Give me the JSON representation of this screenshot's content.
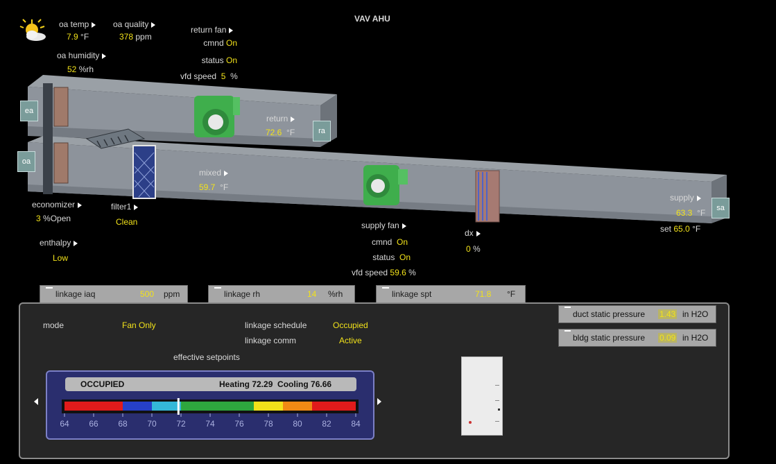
{
  "title": "VAV AHU",
  "outdoor": {
    "temp_label": "oa temp",
    "temp_value": "7.9",
    "temp_unit": "°F",
    "quality_label": "oa quality",
    "quality_value": "378",
    "quality_unit": "ppm",
    "humidity_label": "oa humidity",
    "humidity_value": "52",
    "humidity_unit": "%rh"
  },
  "return_fan": {
    "label": "return fan",
    "cmnd_label": "cmnd",
    "cmnd_value": "On",
    "status_label": "status",
    "status_value": "On",
    "speed_label": "vfd speed",
    "speed_value": "5",
    "speed_unit": "%"
  },
  "return_air": {
    "label": "return",
    "value": "72.6",
    "unit": "°F"
  },
  "mixed_air": {
    "label": "mixed",
    "value": "59.7",
    "unit": "°F"
  },
  "economizer": {
    "label": "economizer",
    "value": "3",
    "unit": "%Open"
  },
  "filter": {
    "label": "filter1",
    "value": "Clean"
  },
  "enthalpy": {
    "label": "enthalpy",
    "value": "Low"
  },
  "supply_fan": {
    "label": "supply fan",
    "cmnd_label": "cmnd",
    "cmnd_value": "On",
    "status_label": "status",
    "status_value": "On",
    "speed_label": "vfd speed",
    "speed_value": "59.6",
    "speed_unit": "%"
  },
  "dx": {
    "label": "dx",
    "value": "0",
    "unit": "%"
  },
  "supply_air": {
    "label": "supply",
    "value": "63.3",
    "unit": "°F",
    "set_label": "set",
    "set_value": "65.0",
    "set_unit": "°F"
  },
  "duct_badges": {
    "ea": "ea",
    "oa": "oa",
    "ra": "ra",
    "sa": "sa"
  },
  "tabs": [
    {
      "label": "linkage iaq",
      "value": "500",
      "unit": "ppm"
    },
    {
      "label": "linkage rh",
      "value": "14",
      "unit": "%rh"
    },
    {
      "label": "linkage spt",
      "value": "71.8",
      "unit": "°F"
    }
  ],
  "pressures": [
    {
      "label": "duct static pressure",
      "value": "1.43",
      "unit": "in H2O"
    },
    {
      "label": "bldg static pressure",
      "value": "0.09",
      "unit": "in H2O"
    }
  ],
  "panel": {
    "mode_label": "mode",
    "mode_value": "Fan Only",
    "schedule_label": "linkage schedule",
    "schedule_value": "Occupied",
    "comm_label": "linkage comm",
    "comm_value": "Active",
    "setpoints_label": "effective setpoints"
  },
  "setpoint_widget": {
    "state": "OCCUPIED",
    "summary": "Heating 72.29  Cooling 76.66",
    "ticks": [
      "64",
      "66",
      "68",
      "70",
      "72",
      "74",
      "76",
      "78",
      "80",
      "82",
      "84"
    ],
    "marker_value": 71.8,
    "scale_min": 64,
    "scale_max": 84
  },
  "colors": {
    "value": "#f2e21a",
    "accent_fan": "#3fae4c"
  }
}
